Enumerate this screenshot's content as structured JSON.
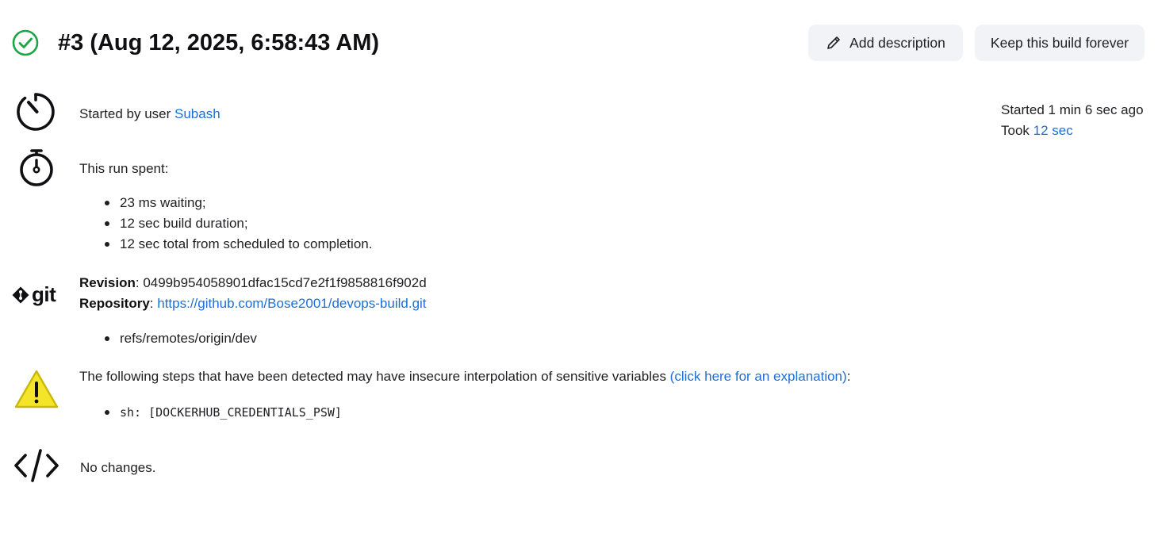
{
  "header": {
    "title": "#3 (Aug 12, 2025, 6:58:43 AM)",
    "status_icon": "check-circle-icon",
    "status_color": "#1ea446",
    "add_description_label": "Add description",
    "keep_forever_label": "Keep this build forever"
  },
  "started": {
    "prefix": "Started by user ",
    "user": "Subash"
  },
  "meta": {
    "started_ago": "Started 1 min 6 sec ago",
    "took_prefix": "Took ",
    "took_value": "12 sec"
  },
  "timing": {
    "heading": "This run spent:",
    "items": [
      "23 ms waiting;",
      "12 sec build duration;",
      "12 sec total from scheduled to completion."
    ]
  },
  "git": {
    "icon_label": "git",
    "revision_label": "Revision",
    "revision_value": "0499b954058901dfac15cd7e2f1f9858816f902d",
    "repository_label": "Repository",
    "repository_url": "https://github.com/Bose2001/devops-build.git",
    "refs": [
      "refs/remotes/origin/dev"
    ]
  },
  "warning": {
    "text": "The following steps that have been detected may have insecure interpolation of sensitive variables ",
    "link": "(click here for an explanation)",
    "suffix": ":",
    "steps": [
      "sh: [DOCKERHUB_CREDENTIALS_PSW]"
    ]
  },
  "changes": {
    "text": "No changes."
  },
  "colors": {
    "link": "#1d6fd6",
    "button_bg": "#f1f3f6",
    "warning_fill": "#f5e52a"
  }
}
